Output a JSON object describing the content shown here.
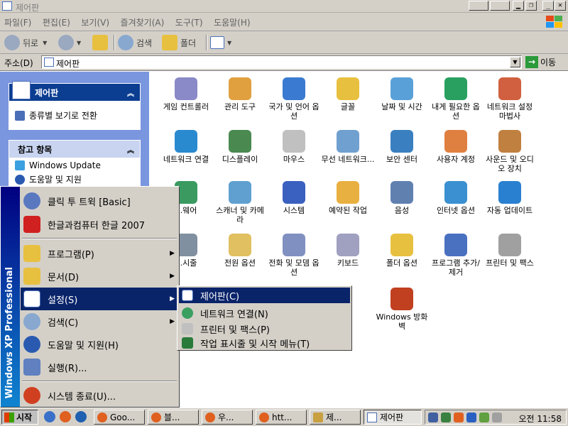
{
  "window": {
    "title": "제어판"
  },
  "menubar": [
    "파일(F)",
    "편집(E)",
    "보기(V)",
    "즐겨찾기(A)",
    "도구(T)",
    "도움말(H)"
  ],
  "toolbar": {
    "back": "뒤로",
    "search": "검색",
    "folders": "폴더"
  },
  "address": {
    "label": "주소(D)",
    "value": "제어판",
    "go": "이동"
  },
  "leftpanel": {
    "control_panel_title": "제어판",
    "switch_view": "종류별 보기로 전환",
    "see_also_title": "참고 항목",
    "links": [
      "Windows Update",
      "도움말 및 지원"
    ]
  },
  "icons": [
    [
      "게임 컨트롤러",
      "관리 도구",
      "국가 및 언어 옵션",
      "글꼴",
      "날짜 및 시간",
      "내게 필요한 옵션",
      "네트워크 설정 마법사"
    ],
    [
      "네트워크 연결",
      "디스플레이",
      "마우스",
      "무선 네트워크...",
      "보안 센터",
      "사용자 계정",
      "사운드 및 오디오 장치"
    ],
    [
      "...웨어",
      "스캐너 및 카메라",
      "시스템",
      "예약된 작업",
      "음성",
      "인터넷 옵션",
      "자동 업데이트"
    ],
    [
      "...시줄",
      "전원 옵션",
      "전화 및 모뎀 옵션",
      "키보드",
      "폴더 옵션",
      "프로그램 추가/제거",
      "프린터 및 팩스"
    ],
    [
      "",
      "",
      "",
      "",
      "Windows 방화벽",
      "",
      ""
    ]
  ],
  "startmenu": {
    "side_label": "Windows XP Professional",
    "pinned": [
      "클릭 투 트윅 [Basic]",
      "한글과컴퓨터 한글 2007"
    ],
    "items": [
      "프로그램(P)",
      "문서(D)",
      "설정(S)",
      "검색(C)",
      "도움말 및 지원(H)",
      "실행(R)..."
    ],
    "shutdown": "시스템 종료(U)..."
  },
  "submenu": [
    "제어판(C)",
    "네트워크 연결(N)",
    "프린터 및 팩스(P)",
    "작업 표시줄 및 시작 메뉴(T)"
  ],
  "taskbar": {
    "start": "시작",
    "buttons": [
      "Goo...",
      "블...",
      "우...",
      "htt...",
      "제...",
      "제어판"
    ],
    "clock": "오전 11:58"
  }
}
